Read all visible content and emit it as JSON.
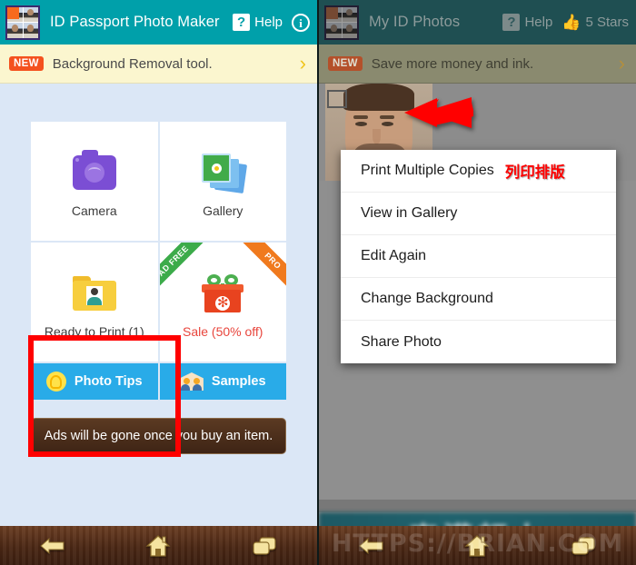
{
  "left": {
    "appbar": {
      "app_icon": "passport-photo-grid-icon",
      "title": "ID Passport Photo Maker",
      "help_badge": "?",
      "help_label": "Help",
      "info_icon": "i"
    },
    "promo": {
      "badge": "NEW",
      "text": "Background Removal tool.",
      "chevron": "›"
    },
    "tiles": [
      {
        "label": "Camera",
        "icon": "camera-icon"
      },
      {
        "label": "Gallery",
        "icon": "gallery-icon"
      },
      {
        "label": "Ready to Print (1)",
        "icon": "folder-photo-icon"
      },
      {
        "label": "Sale (50% off)",
        "icon": "gift-icon",
        "ribbon_left": "AD FREE",
        "ribbon_right": "PRO"
      }
    ],
    "blue_buttons": [
      {
        "label": "Photo Tips",
        "icon": "lightbulb-icon"
      },
      {
        "label": "Samples",
        "icon": "people-icon"
      }
    ],
    "ad_toast": "Ads will be gone once you buy an item."
  },
  "right": {
    "appbar": {
      "app_icon": "passport-photo-grid-icon",
      "title": "My ID Photos",
      "help_badge": "?",
      "help_label": "Help",
      "thumbs_icon": "👍",
      "stars_label": "5 Stars"
    },
    "promo": {
      "badge": "NEW",
      "text": "Save more money and ink.",
      "chevron": "›"
    },
    "photo_item": {
      "checkbox_checked": false,
      "thumbnail": "portrait-photo-thumbnail"
    },
    "context_menu": [
      {
        "label": "Print Multiple Copies",
        "annotation": "列印排版"
      },
      {
        "label": "View in Gallery",
        "annotation": ""
      },
      {
        "label": "Edit Again",
        "annotation": ""
      },
      {
        "label": "Change Background",
        "annotation": ""
      },
      {
        "label": "Share Photo",
        "annotation": ""
      }
    ],
    "bottom_ad": "車灌軒人",
    "watermark": "HTTPS://BRIAN.COM"
  },
  "navbar": {
    "back": "back-arrow-icon",
    "home": "home-icon",
    "recents": "recents-icon"
  },
  "colors": {
    "teal": "#00a0aa",
    "teal_dim": "#1f4f52",
    "promo_bg": "#fbf6cf",
    "new_badge": "#f4511e",
    "panel_bg": "#dbe7f6",
    "blue_button": "#29abe8",
    "sale_red": "#e8453c",
    "highlight_red": "#ff0000",
    "wood": "#4a2714"
  }
}
